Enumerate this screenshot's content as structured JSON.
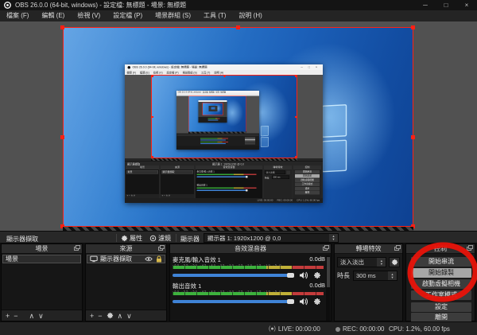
{
  "window": {
    "title": "OBS 26.0.0 (64-bit, windows) - 設定檔: 無標題 - 場景: 無標題"
  },
  "icons": {
    "obs_logo": "obs-circle-logo",
    "minimize": "─",
    "maximize": "□",
    "close": "×",
    "spin_up": "▴",
    "spin_down": "▾",
    "plus": "+",
    "minus": "−",
    "up": "∧",
    "down": "∨",
    "live": "(●)",
    "rec_dot": "●"
  },
  "menu": {
    "items": [
      "檔案 (F)",
      "編輯 (E)",
      "檢視 (V)",
      "設定檔 (P)",
      "場景群組 (S)",
      "工具 (T)",
      "說明 (H)"
    ]
  },
  "source_toolbar": {
    "source_name": "顯示器擷取",
    "properties_label": "屬性",
    "filters_label": "濾鏡",
    "display_label": "顯示器",
    "display_value": "顯示器 1: 1920x1200 @ 0,0"
  },
  "panels": {
    "scenes": {
      "title": "場景",
      "items": [
        "場景"
      ]
    },
    "sources": {
      "title": "來源",
      "items": [
        {
          "name": "顯示器擷取"
        }
      ]
    },
    "mixer": {
      "title": "音效混音器",
      "ticks": "-60 -55 -50 -45 -40 -35 -30 -25 -20 -15 -10 -5 0",
      "channels": [
        {
          "name": "麥克風/輸入音效 1",
          "volume_db": "0.0dB"
        },
        {
          "name": "輸出音效 1",
          "volume_db": "0.0dB"
        }
      ]
    },
    "transitions": {
      "title": "轉場特效",
      "current": "淡入淡出",
      "duration_label": "時長",
      "duration_value": "300 ms"
    },
    "controls": {
      "title": "控制",
      "buttons": [
        "開始串流",
        "開始錄製",
        "啟動虛擬相機",
        "工作室模式",
        "設定",
        "離開"
      ],
      "highlighted": "開始錄製"
    }
  },
  "status_bar": {
    "live_label": "LIVE: 00:00:00",
    "rec_label": "REC: 00:00:00",
    "cpu_label": "CPU: 1.2%, 60.00 fps"
  },
  "annotation": {
    "type": "red-circle-highlight",
    "target": "開始錄製",
    "color": "#e8130a"
  },
  "colors": {
    "selection_red": "#ff2014",
    "volume_blue": "#3f83d6",
    "desktop_blue": "#1c60b8"
  }
}
